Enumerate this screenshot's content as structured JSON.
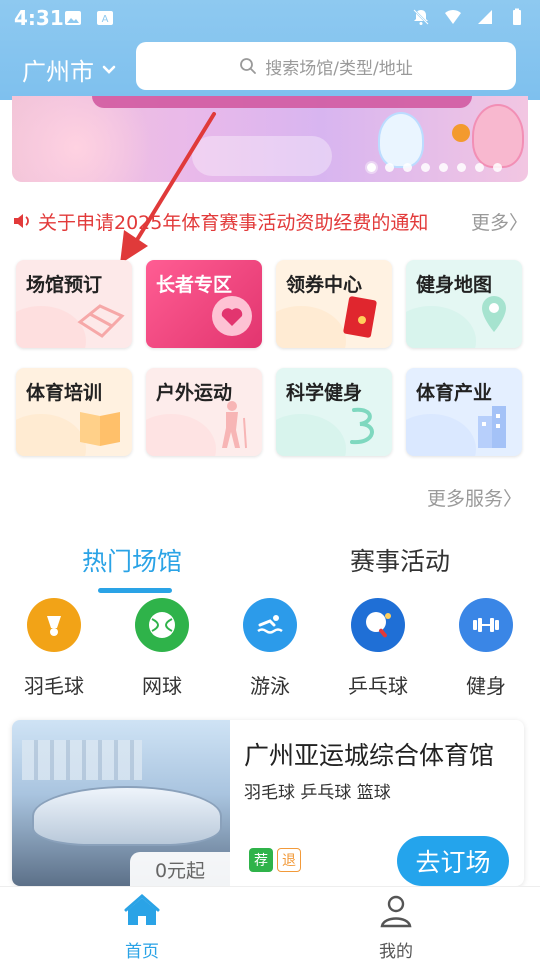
{
  "status_bar": {
    "time": "4:31"
  },
  "header": {
    "city": "广州市",
    "search_placeholder": "搜索场馆/类型/地址"
  },
  "banner": {
    "dot_count": 8
  },
  "notice": {
    "text": "关于申请2025年体育赛事活动资助经费的通知",
    "more": "更多"
  },
  "services": [
    {
      "label": "场馆预订"
    },
    {
      "label": "长者专区"
    },
    {
      "label": "领券中心"
    },
    {
      "label": "健身地图"
    },
    {
      "label": "体育培训"
    },
    {
      "label": "户外运动"
    },
    {
      "label": "科学健身"
    },
    {
      "label": "体育产业"
    }
  ],
  "more_services": "更多服务",
  "tabs": [
    {
      "label": "热门场馆",
      "active": true
    },
    {
      "label": "赛事活动",
      "active": false
    }
  ],
  "sports": [
    {
      "name": "羽毛球",
      "color": "#f2a317",
      "icon": "badminton-icon"
    },
    {
      "name": "网球",
      "color": "#2fb34a",
      "icon": "tennis-icon"
    },
    {
      "name": "游泳",
      "color": "#2c9bea",
      "icon": "swimming-icon"
    },
    {
      "name": "乒乓球",
      "color": "#1f6fd6",
      "icon": "table-tennis-icon"
    },
    {
      "name": "健身",
      "color": "#3a86e6",
      "icon": "fitness-icon"
    }
  ],
  "venue": {
    "title": "广州亚运城综合体育馆",
    "tags": "羽毛球 乒乓球 篮球",
    "price": "0元起",
    "badge_recommend": "荐",
    "badge_refund": "退",
    "book_button": "去订场"
  },
  "bottom_nav": [
    {
      "label": "首页",
      "active": true
    },
    {
      "label": "我的",
      "active": false
    }
  ]
}
